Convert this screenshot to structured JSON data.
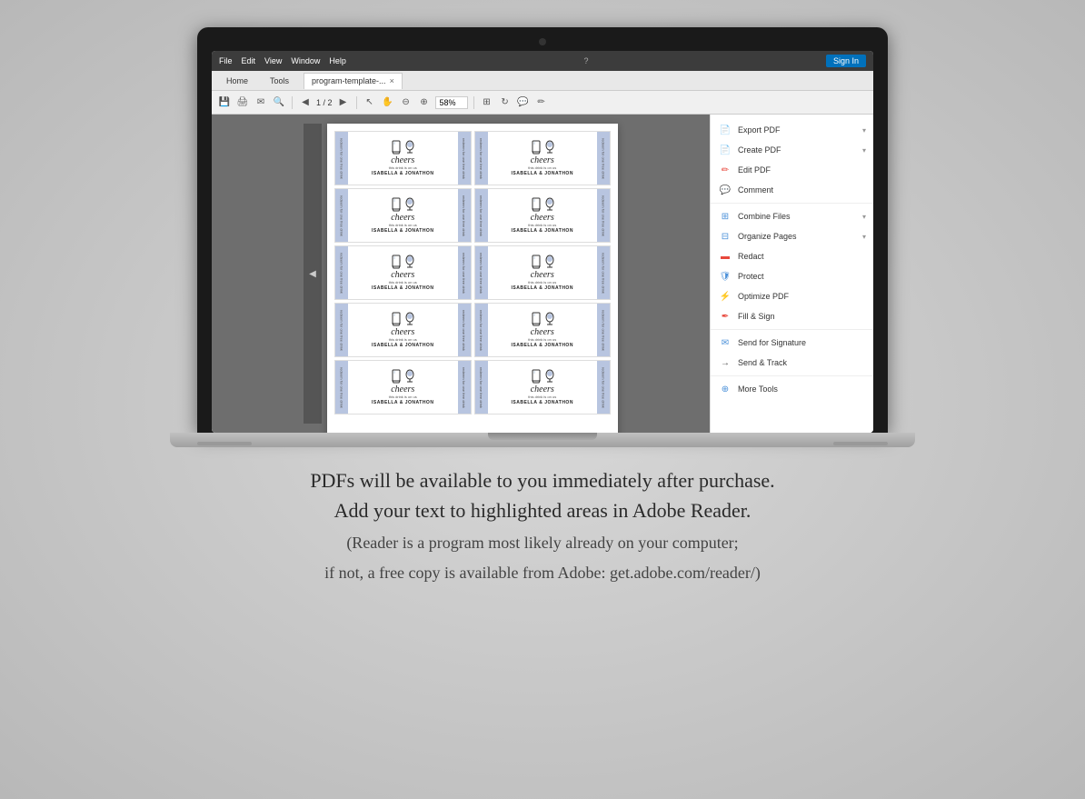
{
  "laptop": {
    "screen": {
      "adobe": {
        "menu": {
          "items": [
            "File",
            "Edit",
            "View",
            "Window",
            "Help"
          ]
        },
        "tabs": {
          "home": "Home",
          "tools": "Tools",
          "file_tab": "program-template-...",
          "close_label": "×"
        },
        "sign_in": "Sign In",
        "toolbar": {
          "page_indicator": "1 / 2",
          "zoom": "58%"
        },
        "sidebar": {
          "tools": [
            {
              "label": "Export PDF",
              "color": "#e8483c",
              "has_arrow": true
            },
            {
              "label": "Create PDF",
              "color": "#e8483c",
              "has_arrow": true
            },
            {
              "label": "Edit PDF",
              "color": "#e8483c",
              "has_arrow": false
            },
            {
              "label": "Comment",
              "color": "#f5a623",
              "has_arrow": false
            },
            {
              "label": "Combine Files",
              "color": "#4a90d9",
              "has_arrow": true
            },
            {
              "label": "Organize Pages",
              "color": "#4a90d9",
              "has_arrow": true
            },
            {
              "label": "Redact",
              "color": "#e8483c",
              "has_arrow": false
            },
            {
              "label": "Protect",
              "color": "#4a90d9",
              "has_arrow": false
            },
            {
              "label": "Optimize PDF",
              "color": "#e8483c",
              "has_arrow": false
            },
            {
              "label": "Fill & Sign",
              "color": "#e8483c",
              "has_arrow": false
            },
            {
              "label": "Send for Signature",
              "color": "#4a90d9",
              "has_arrow": false
            },
            {
              "label": "Send & Track",
              "color": "#555",
              "has_arrow": false
            },
            {
              "label": "More Tools",
              "color": "#4a90d9",
              "has_arrow": false
            }
          ]
        }
      }
    }
  },
  "tickets": {
    "cheers_text": "cheers",
    "subtext": "this drink is on us",
    "names": "ISABELLA & JONATHON",
    "side_text": "redeem for one free drink"
  },
  "bottom_text": {
    "line1": "PDFs will be available to you immediately after purchase.",
    "line2": "Add your text to highlighted areas in Adobe Reader.",
    "line3": "(Reader is a program most likely already on your computer;",
    "line4": "if not, a free copy is available from Adobe: get.adobe.com/reader/)"
  }
}
